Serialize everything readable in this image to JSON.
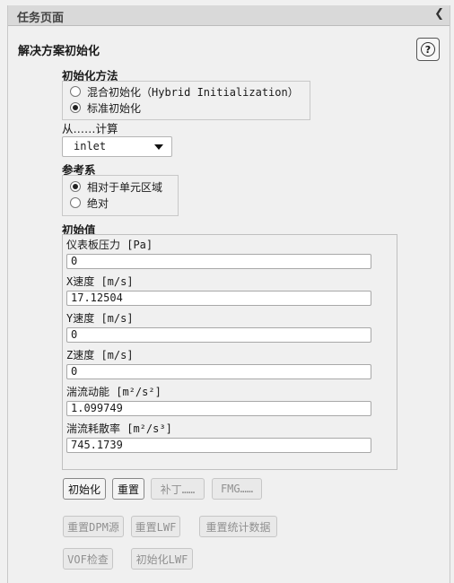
{
  "header": {
    "title": "任务页面",
    "collapse_icon": "chevron-left-icon"
  },
  "section_title": "解决方案初始化",
  "help_icon": "question-circle-icon",
  "init_method": {
    "label": "初始化方法",
    "options": [
      "混合初始化（Hybrid Initialization）",
      "标准初始化"
    ],
    "selected": "标准初始化"
  },
  "compute_from": {
    "label": "从……计算",
    "value": "inlet"
  },
  "reference_frame": {
    "label": "参考系",
    "options": [
      "相对于单元区域",
      "绝对"
    ],
    "selected": "相对于单元区域"
  },
  "initial_values": {
    "label": "初始值",
    "fields": [
      {
        "label": "仪表板压力 [Pa]",
        "value": "0"
      },
      {
        "label": "X速度 [m/s]",
        "value": "17.12504"
      },
      {
        "label": "Y速度 [m/s]",
        "value": "0"
      },
      {
        "label": "Z速度 [m/s]",
        "value": "0"
      },
      {
        "label": "湍流动能 [m²/s²]",
        "value": "1.099749"
      },
      {
        "label": "湍流耗散率 [m²/s³]",
        "value": "745.1739"
      }
    ]
  },
  "buttons": {
    "initialize": "初始化",
    "reset": "重置",
    "patch": "补丁……",
    "fmg": "FMG……",
    "reset_dpm": "重置DPM源",
    "reset_lwf": "重置LWF",
    "reset_stats": "重置统计数据",
    "vof_check": "VOF检查",
    "init_lwf": "初始化LWF"
  }
}
